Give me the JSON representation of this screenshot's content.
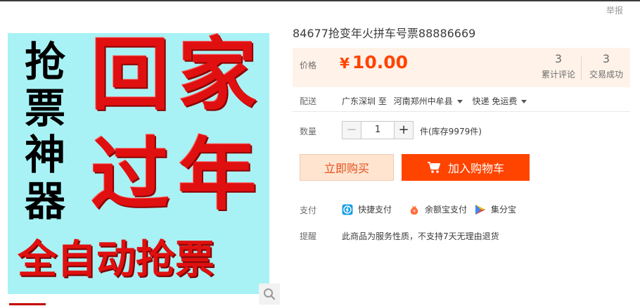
{
  "header": {
    "report_label": "举报"
  },
  "product_image": {
    "side_text": "抢票神器",
    "big_chars": [
      "回",
      "家",
      "过",
      "年"
    ],
    "bottom_text": "全自动抢票"
  },
  "product": {
    "title": "84677抢变年火拼车号票88886669"
  },
  "price": {
    "label": "价格",
    "currency": "¥",
    "value": "10.00",
    "stats": [
      {
        "count": "3",
        "label": "累计评论"
      },
      {
        "count": "3",
        "label": "交易成功"
      }
    ]
  },
  "shipping": {
    "label": "配送",
    "from_to": "广东深圳 至",
    "destination": "河南郑州中牟县",
    "method": "快递 免运费"
  },
  "quantity": {
    "label": "数量",
    "minus": "−",
    "value": "1",
    "plus": "+",
    "stock_text": "件(库存9979件)"
  },
  "actions": {
    "buy_now": "立即购买",
    "add_to_cart": "加入购物车"
  },
  "payment": {
    "label": "支付",
    "methods": [
      "快捷支付",
      "余额宝支付",
      "集分宝"
    ]
  },
  "reminder": {
    "label": "提醒",
    "text": "此商品为服务性质，不支持7天无理由退货"
  },
  "colors": {
    "accent": "#ff4400",
    "price": "#ff4400",
    "panel_bg": "#fff2e8"
  }
}
